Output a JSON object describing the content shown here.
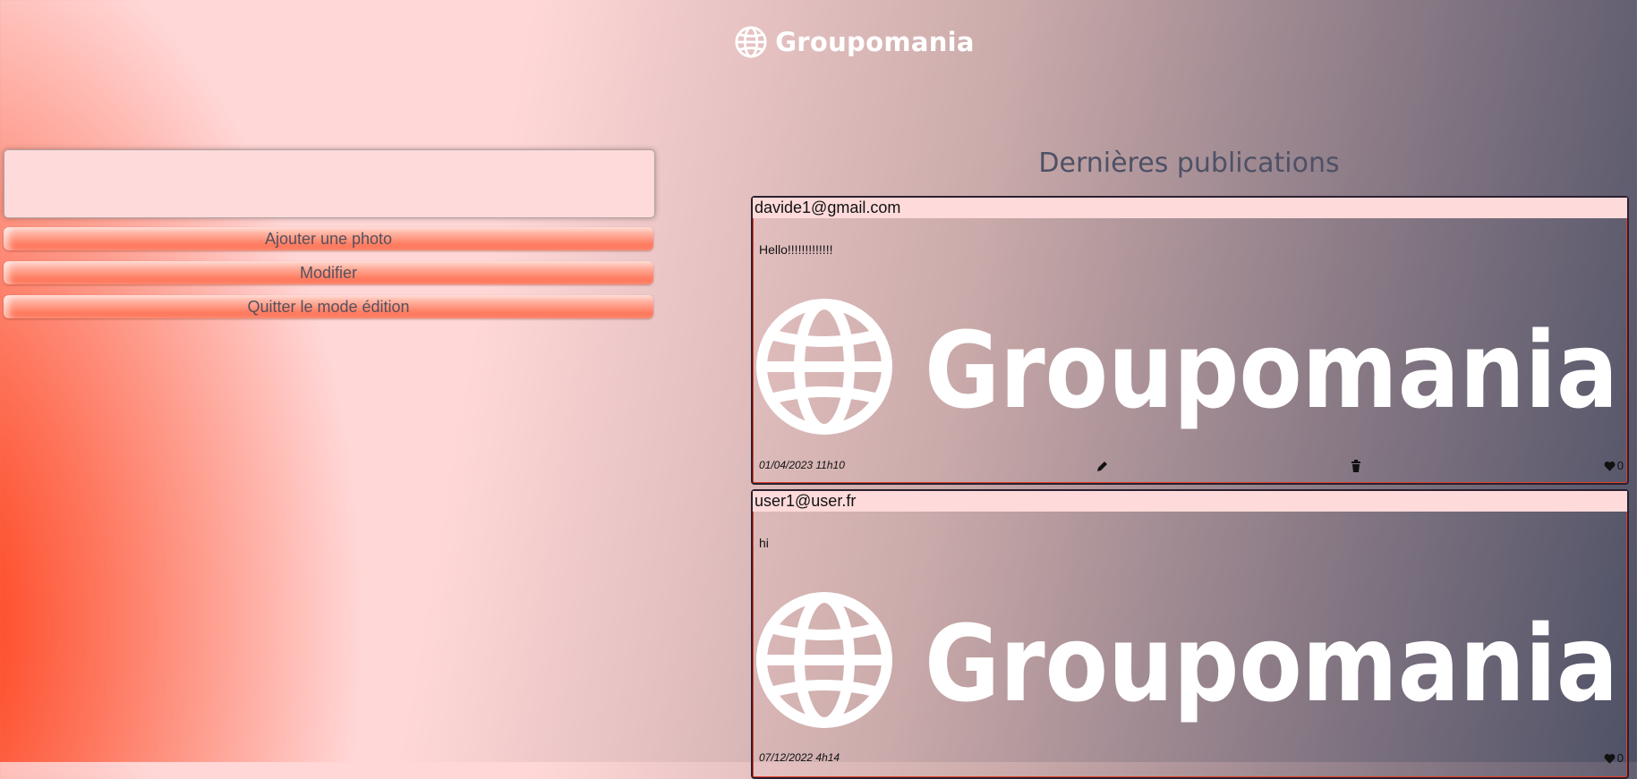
{
  "header": {
    "brand": "Groupomania"
  },
  "editor": {
    "text_value": "",
    "buttons": {
      "add_photo": "Ajouter une photo",
      "modify": "Modifier",
      "quit_edit": "Quitter le mode édition"
    }
  },
  "feed": {
    "title": "Dernières publications",
    "posts": [
      {
        "author": "davide1@gmail.com",
        "text": "Hello!!!!!!!!!!!!!",
        "image_brand": "Groupomania",
        "date": "01/04/2023 11h10",
        "likes": "0"
      },
      {
        "author": "user1@user.fr",
        "text": "hi",
        "image_brand": "Groupomania",
        "date": "07/12/2022 4h14",
        "likes": "0"
      }
    ]
  },
  "icons": {
    "logo": "globe-icon",
    "edit": "pencil-icon",
    "delete": "trash-icon",
    "like": "heart-icon"
  },
  "colors": {
    "primary": "#fd2d01",
    "secondary": "#ffd7d7",
    "tertiary": "#4e5166"
  }
}
